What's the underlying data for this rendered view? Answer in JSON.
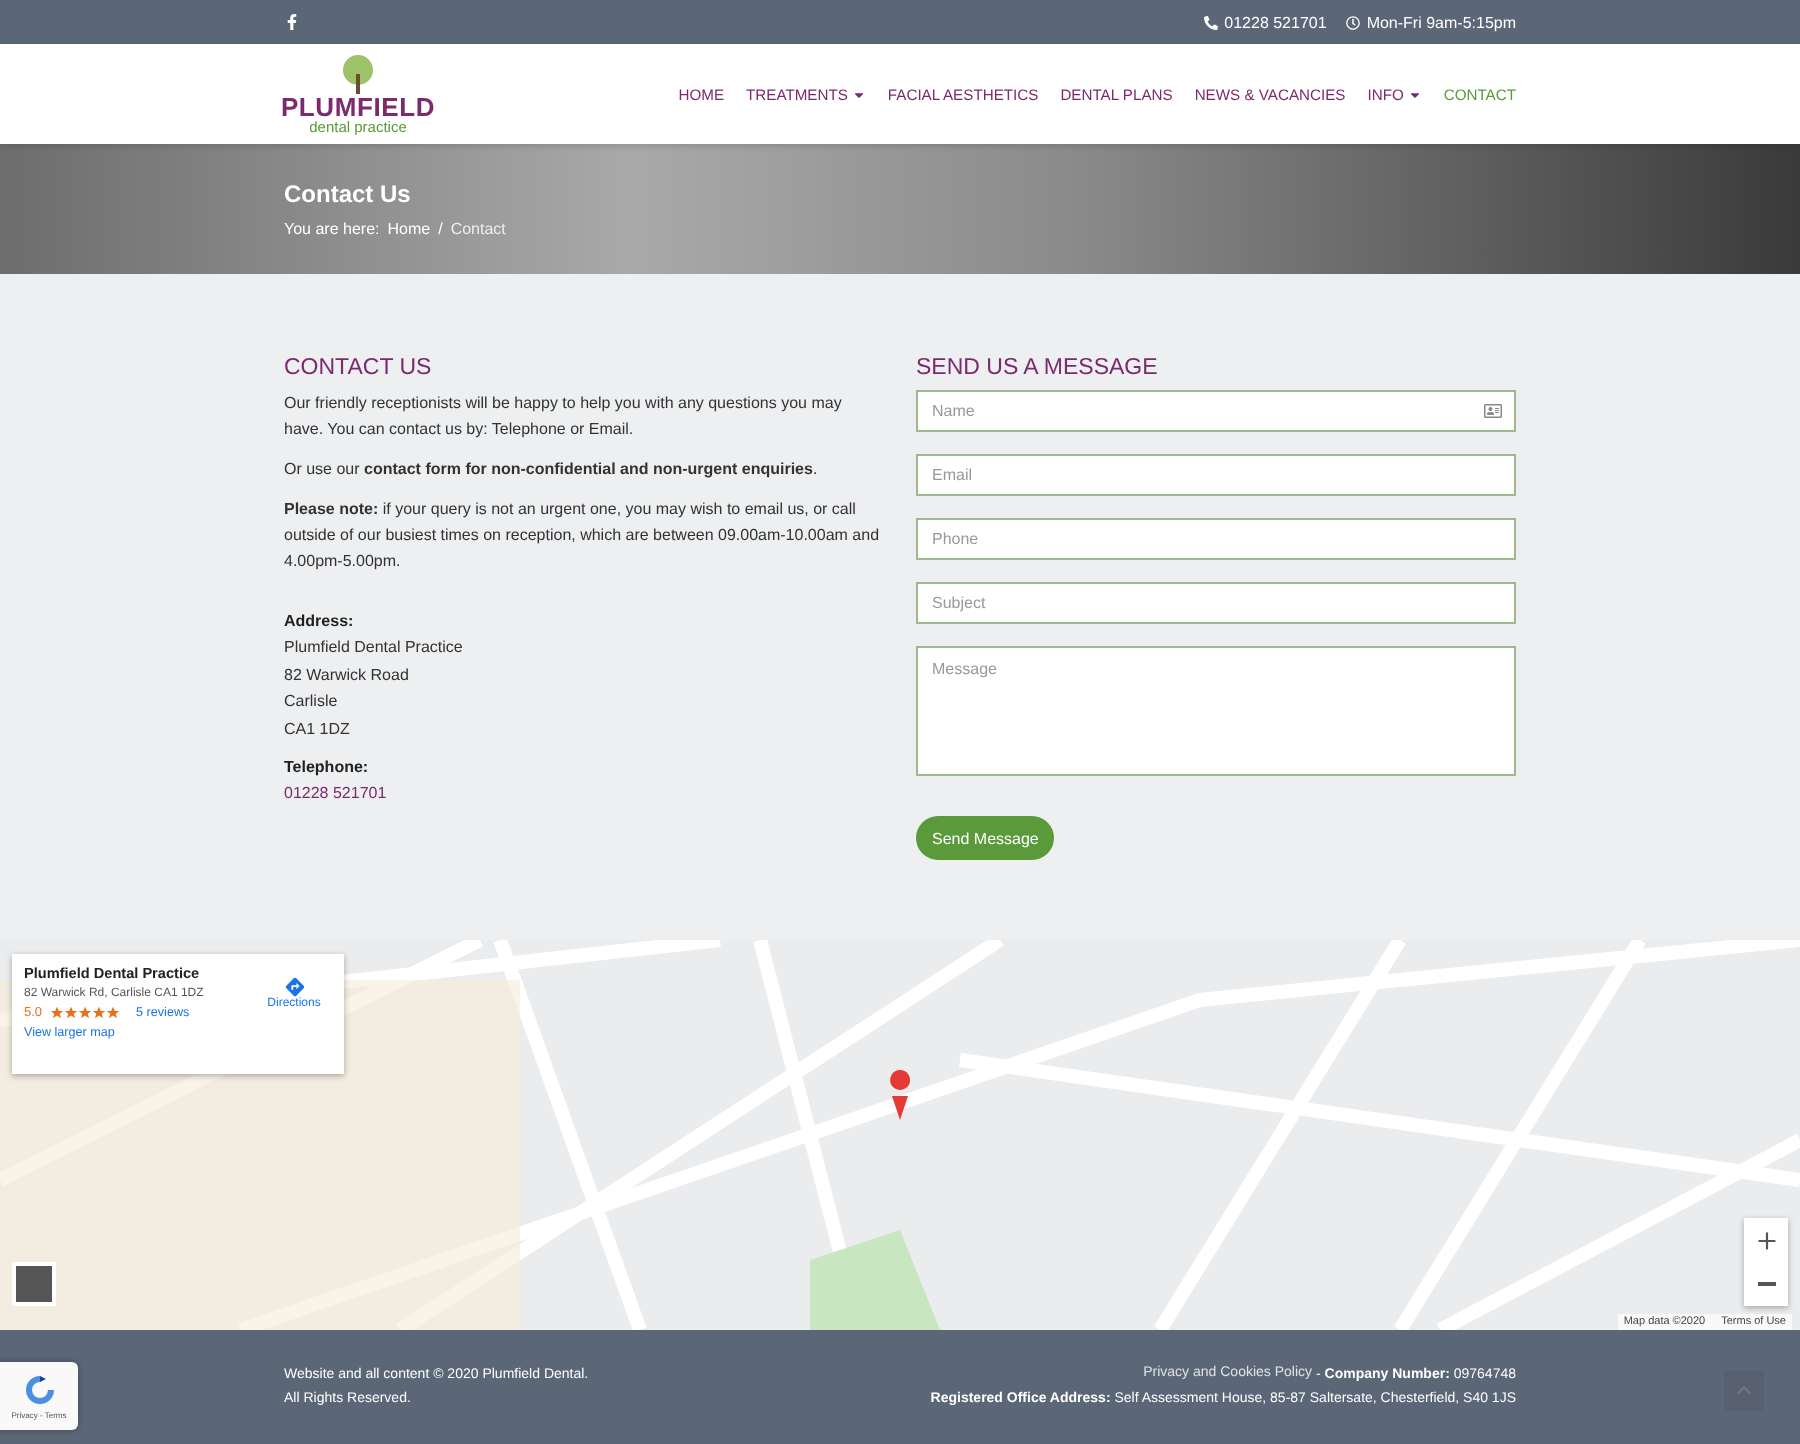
{
  "topbar": {
    "phone": "01228 521701",
    "hours": "Mon-Fri 9am-5:15pm"
  },
  "header": {
    "logo": {
      "name": "PLUMFIELD",
      "tagline": "dental practice"
    },
    "nav": [
      {
        "label": "HOME",
        "dropdown": false,
        "selected": false
      },
      {
        "label": "TREATMENTS",
        "dropdown": true,
        "selected": false
      },
      {
        "label": "FACIAL AESTHETICS",
        "dropdown": false,
        "selected": false
      },
      {
        "label": "DENTAL PLANS",
        "dropdown": false,
        "selected": false
      },
      {
        "label": "NEWS & VACANCIES",
        "dropdown": false,
        "selected": false
      },
      {
        "label": "INFO",
        "dropdown": true,
        "selected": false
      },
      {
        "label": "CONTACT",
        "dropdown": false,
        "selected": true
      }
    ]
  },
  "banner": {
    "title": "Contact Us",
    "breadcrumb_prefix": "You are here:",
    "breadcrumb_separator": "/",
    "breadcrumb": [
      "Home",
      "Contact"
    ]
  },
  "contact": {
    "heading": "CONTACT US",
    "paragraphs": [
      "Our friendly receptionists will be happy to help you with any questions you may have. You can contact us by: Telephone or Email.",
      "Or use our **contact form for non-confidential and non-urgent enquiries**.",
      "**Please note:** if your query is not an urgent one, you may wish to email us, or call outside of our busiest times on reception, which are between 09.00am-10.00am and 4.00pm-5.00pm."
    ],
    "address_label": "Address:",
    "address_lines": [
      "Plumfield Dental Practice",
      "82 Warwick Road",
      "Carlisle",
      "CA1 1DZ"
    ],
    "telephone_label": "Telephone:",
    "telephone": "01228 521701"
  },
  "form": {
    "heading": "SEND US A MESSAGE",
    "fields": [
      {
        "kind": "input",
        "placeholder": "Name",
        "icon": true
      },
      {
        "kind": "input",
        "placeholder": "Email",
        "icon": false
      },
      {
        "kind": "input",
        "placeholder": "Phone",
        "icon": false
      },
      {
        "kind": "input",
        "placeholder": "Subject",
        "icon": false
      },
      {
        "kind": "textarea",
        "placeholder": "Message",
        "icon": false
      }
    ],
    "button": "Send Message"
  },
  "map": {
    "card": {
      "name": "Plumfield Dental Practice",
      "address": "82 Warwick Rd, Carlisle CA1 1DZ",
      "rating": "5.0",
      "stars": 5,
      "reviews": "5 reviews",
      "directions": "Directions",
      "link": "View larger map"
    },
    "attribution": "Map data ©2020",
    "terms": "Terms of Use"
  },
  "footer": {
    "left": [
      "Website and all content © 2020 Plumfield Dental.",
      "All Rights Reserved."
    ],
    "privacy_link": "Privacy and Cookies Policy",
    "company": " - **Company Number:** 09764748",
    "office": "**Registered Office Address:** Self Assessment House, 85-87 Saltersate, Chesterfield, S40 1JS",
    "recaptcha": "Privacy - Terms"
  }
}
